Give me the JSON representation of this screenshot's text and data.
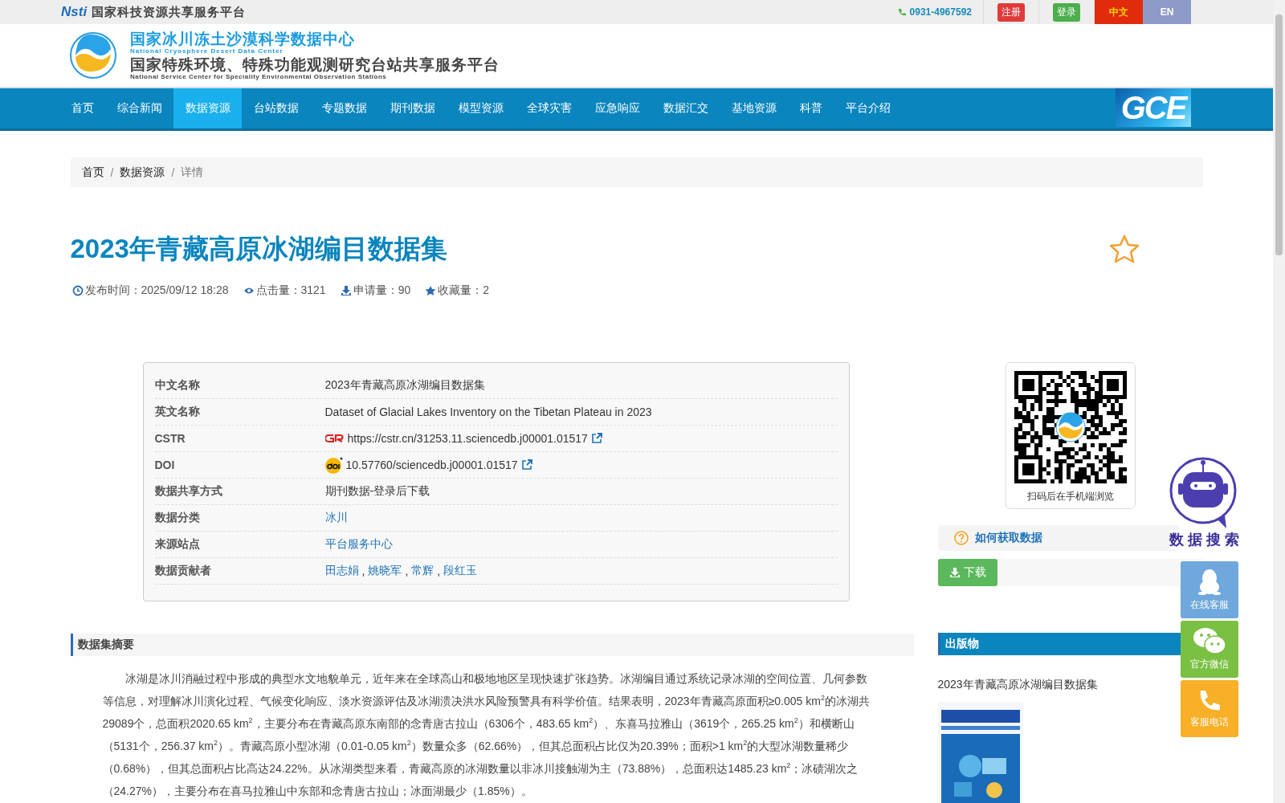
{
  "topbar": {
    "logo": "Nsti",
    "site": "国家科技资源共享服务平台",
    "phone": "0931-4967592",
    "register": "注册",
    "login": "登录",
    "languages": [
      {
        "label": "中文",
        "selected": true
      },
      {
        "label": "EN",
        "selected": false
      }
    ]
  },
  "header": {
    "title_cn": "国家冰川冻土沙漠科学数据中心",
    "title_en": "National Cryosphere Desert Data Center",
    "subtitle_cn": "国家特殊环境、特殊功能观测研究台站共享服务平台",
    "subtitle_en": "National Service Center for Speciality Environmental Observation Stations"
  },
  "nav": {
    "items": [
      {
        "label": "首页",
        "selected": false
      },
      {
        "label": "综合新闻",
        "selected": false
      },
      {
        "label": "数据资源",
        "selected": true
      },
      {
        "label": "台站数据",
        "selected": false
      },
      {
        "label": "专题数据",
        "selected": false
      },
      {
        "label": "期刊数据",
        "selected": false
      },
      {
        "label": "模型资源",
        "selected": false
      },
      {
        "label": "全球灾害",
        "selected": false
      },
      {
        "label": "应急响应",
        "selected": false
      },
      {
        "label": "数据汇交",
        "selected": false
      },
      {
        "label": "基地资源",
        "selected": false
      },
      {
        "label": "科普",
        "selected": false
      },
      {
        "label": "平台介绍",
        "selected": false
      }
    ],
    "logo": "GCE"
  },
  "breadcrumb_separator": "/",
  "link_separator": ",",
  "breadcrumb": [
    {
      "label": "首页",
      "kind": "link"
    },
    {
      "label": "数据资源",
      "kind": "link"
    },
    {
      "label": "详情",
      "kind": "current"
    }
  ],
  "dataset": {
    "title": "2023年青藏高原冰湖编目数据集",
    "favorite": {
      "selected": false
    },
    "meta": [
      {
        "kind": "time",
        "text": "发布时间：2025/09/12 18:28"
      },
      {
        "kind": "views",
        "text": "点击量：3121"
      },
      {
        "kind": "requests",
        "text": "申请量：90"
      },
      {
        "kind": "favorites",
        "text": "收藏量：2"
      }
    ]
  },
  "info": [
    {
      "label": "中文名称",
      "kind": "text",
      "value": "2023年青藏高原冰湖编目数据集"
    },
    {
      "label": "英文名称",
      "kind": "text",
      "value": "Dataset of Glacial Lakes Inventory on the Tibetan Plateau in 2023"
    },
    {
      "label": "CSTR",
      "kind": "cstr",
      "value": "https://cstr.cn/31253.11.sciencedb.j00001.01517"
    },
    {
      "label": "DOI",
      "kind": "doi",
      "value": "10.57760/sciencedb.j00001.01517"
    },
    {
      "label": "数据共享方式",
      "kind": "text",
      "value": "期刊数据-登录后下载"
    },
    {
      "label": "数据分类",
      "kind": "links",
      "links": [
        "冰川"
      ]
    },
    {
      "label": "来源站点",
      "kind": "links",
      "links": [
        "平台服务中心"
      ]
    },
    {
      "label": "数据贡献者",
      "kind": "links",
      "links": [
        "田志娟",
        "姚晓军",
        "常辉",
        "段红玉"
      ]
    }
  ],
  "qr": {
    "caption": "扫码后在手机端浏览"
  },
  "howto": "如何获取数据",
  "download": "下载",
  "assistant": {
    "label": "数 据 搜 索"
  },
  "float_buttons": [
    {
      "kind": "qq",
      "label": "在线客服",
      "color": "#6fa8dc"
    },
    {
      "kind": "wechat",
      "label": "官方微信",
      "color": "#7ac143"
    },
    {
      "kind": "phone",
      "label": "客服电话",
      "color": "#f7b027"
    }
  ],
  "publications": {
    "heading": "出版物",
    "items": [
      {
        "title": "2023年青藏高原冰湖编目数据集",
        "kind": "picture"
      }
    ]
  },
  "abstract": {
    "heading": "数据集摘要",
    "text": "冰湖是冰川消融过程中形成的典型水文地貌单元，近年来在全球高山和极地地区呈现快速扩张趋势。冰湖编目通过系统记录冰湖的空间位置、几何参数等信息，对理解冰川演化过程、气候变化响应、淡水资源评估及冰湖溃决洪水风险预警具有科学价值。结果表明，2023年青藏高原面积≥0.005 km$^{2}$的冰湖共29089个，总面积2020.65 km$^{2}$，主要分布在青藏高原东南部的念青唐古拉山（6306个，483.65 km$^{2}$）、东喜马拉雅山（3619个，265.25 km$^{2}$）和横断山（5131个，256.37 km$^{2}$）。青藏高原小型冰湖（0.01-0.05 km$^{2}$）数量众多（62.66%），但其总面积占比仅为20.39%；面积>1 km$^{2}$的大型冰湖数量稀少（0.68%），但其总面积占比高达24.22%。从冰湖类型来看，青藏高原的冰湖数量以非冰川接触湖为主（73.88%），总面积达1485.23 km$^{2}$；冰碛湖次之（24.27%），主要分布在喜马拉雅山中东部和念青唐古拉山；冰面湖最少（1.85%）。"
  }
}
